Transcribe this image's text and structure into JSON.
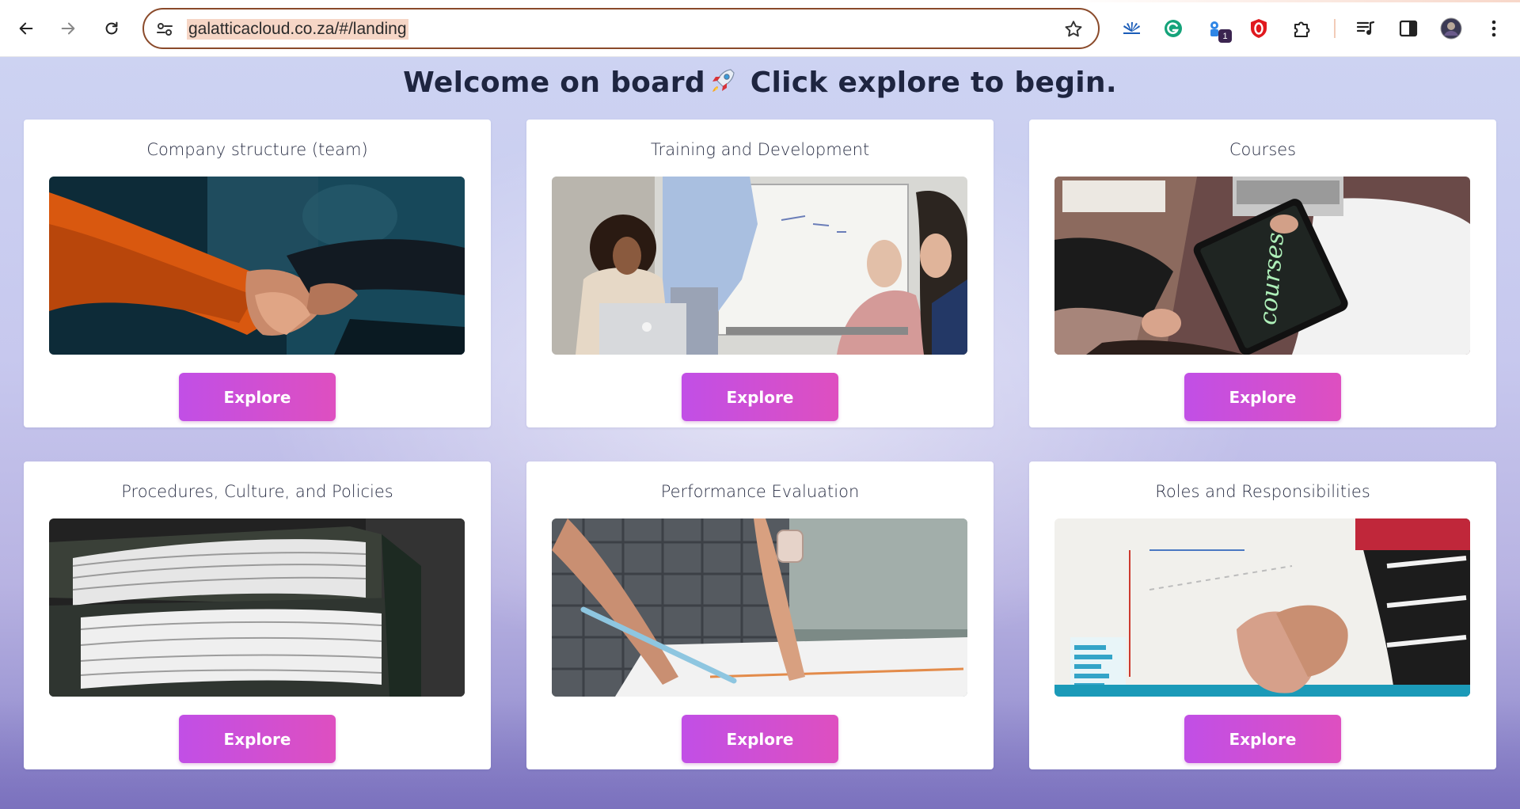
{
  "browser": {
    "url": "galatticacloud.co.za/#/landing",
    "extension_badge": "1"
  },
  "page": {
    "welcome_before": "Welcome on board",
    "welcome_after": " Click explore to begin."
  },
  "cards": [
    {
      "title": "Company structure (team)",
      "button": "Explore"
    },
    {
      "title": "Training and Development",
      "button": "Explore"
    },
    {
      "title": "Courses",
      "button": "Explore"
    },
    {
      "title": "Procedures, Culture, and Policies",
      "button": "Explore"
    },
    {
      "title": "Performance Evaluation",
      "button": "Explore"
    },
    {
      "title": "Roles and Responsibilities",
      "button": "Explore"
    }
  ],
  "images": {
    "courses_tablet_text": "courses"
  },
  "colors": {
    "button_gradient_start": "#c14fe6",
    "button_gradient_end": "#de4fc0",
    "url_highlight": "#f6d6c6",
    "url_border": "#8a4a2a"
  },
  "icons": {
    "back": "back-arrow-icon",
    "forward": "forward-arrow-icon",
    "reload": "reload-icon",
    "site_settings": "tune-icon",
    "bookmark": "star-icon",
    "menu": "kebab-menu-icon"
  }
}
